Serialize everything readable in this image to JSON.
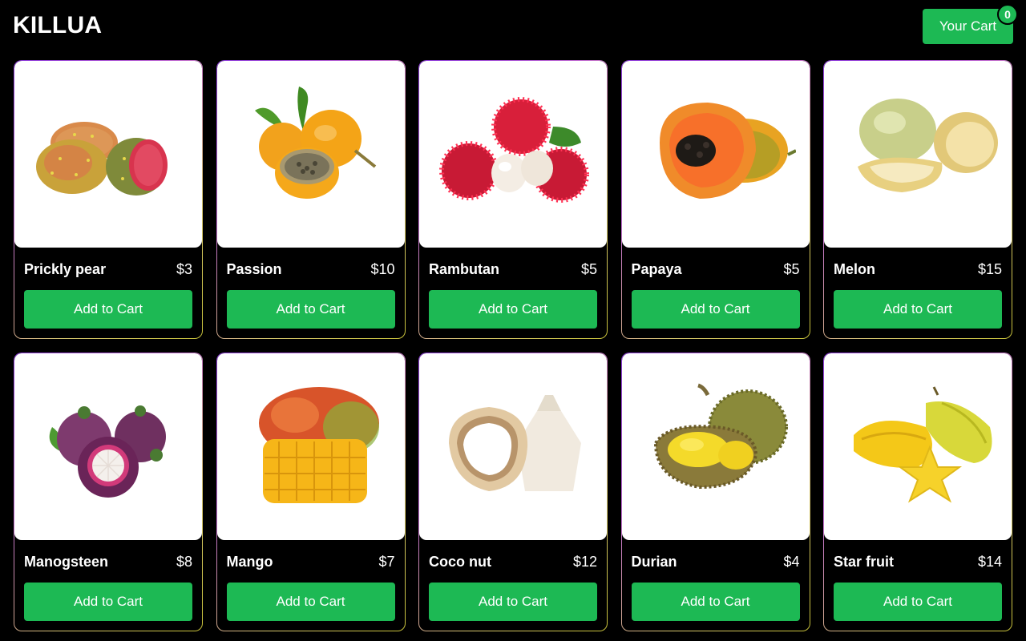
{
  "header": {
    "brand": "KILLUA",
    "cart_label": "Your Cart",
    "cart_count": "0"
  },
  "products": [
    {
      "name": "Prickly pear",
      "price": "$3",
      "button": "Add to Cart",
      "image": "prickly-pear-image"
    },
    {
      "name": "Passion",
      "price": "$10",
      "button": "Add to Cart",
      "image": "passion-fruit-image"
    },
    {
      "name": "Rambutan",
      "price": "$5",
      "button": "Add to Cart",
      "image": "rambutan-image"
    },
    {
      "name": "Papaya",
      "price": "$5",
      "button": "Add to Cart",
      "image": "papaya-image"
    },
    {
      "name": "Melon",
      "price": "$15",
      "button": "Add to Cart",
      "image": "melon-image"
    },
    {
      "name": "Manogsteen",
      "price": "$8",
      "button": "Add to Cart",
      "image": "mangosteen-image"
    },
    {
      "name": "Mango",
      "price": "$7",
      "button": "Add to Cart",
      "image": "mango-image"
    },
    {
      "name": "Coco nut",
      "price": "$12",
      "button": "Add to Cart",
      "image": "coconut-image"
    },
    {
      "name": "Durian",
      "price": "$4",
      "button": "Add to Cart",
      "image": "durian-image"
    },
    {
      "name": "Star fruit",
      "price": "$14",
      "button": "Add to Cart",
      "image": "star-fruit-image"
    }
  ],
  "colors": {
    "accent": "#1db954",
    "background": "#000000",
    "card_border_start": "#8b3bd9",
    "card_border_end": "#c8c23a"
  }
}
